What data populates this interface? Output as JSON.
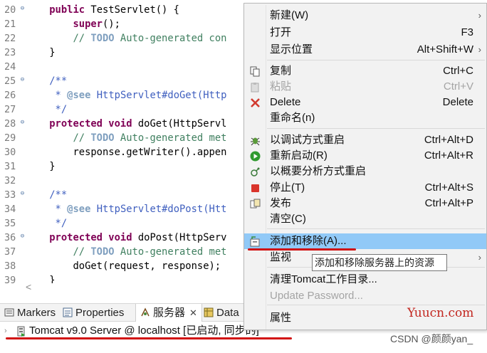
{
  "editor": {
    "lines": [
      {
        "n": "20",
        "fold": "⊖",
        "parts": [
          {
            "t": "    "
          },
          {
            "c": "kw",
            "t": "public"
          },
          {
            "t": " TestServlet() {"
          }
        ]
      },
      {
        "n": "21",
        "parts": [
          {
            "t": "        "
          },
          {
            "c": "kw",
            "t": "super"
          },
          {
            "t": "();"
          }
        ]
      },
      {
        "n": "22",
        "parts": [
          {
            "t": "        "
          },
          {
            "c": "cm",
            "t": "// "
          },
          {
            "c": "jt",
            "t": "TODO"
          },
          {
            "c": "cm",
            "t": " Auto-generated con"
          }
        ]
      },
      {
        "n": "23",
        "parts": [
          {
            "t": "    }"
          }
        ]
      },
      {
        "n": "24",
        "parts": [
          {
            "t": ""
          }
        ]
      },
      {
        "n": "25",
        "fold": "⊖",
        "parts": [
          {
            "t": "    "
          },
          {
            "c": "jd",
            "t": "/**"
          }
        ]
      },
      {
        "n": "26",
        "parts": [
          {
            "t": "     "
          },
          {
            "c": "jd",
            "t": "* "
          },
          {
            "c": "jt",
            "t": "@see"
          },
          {
            "c": "jd",
            "t": " HttpServlet#doGet(Http"
          }
        ]
      },
      {
        "n": "27",
        "parts": [
          {
            "t": "     "
          },
          {
            "c": "jd",
            "t": "*/"
          }
        ]
      },
      {
        "n": "28",
        "fold": "⊖",
        "parts": [
          {
            "t": "    "
          },
          {
            "c": "kw",
            "t": "protected void"
          },
          {
            "t": " doGet(HttpServl"
          }
        ]
      },
      {
        "n": "29",
        "parts": [
          {
            "t": "        "
          },
          {
            "c": "cm",
            "t": "// "
          },
          {
            "c": "jt",
            "t": "TODO"
          },
          {
            "c": "cm",
            "t": " Auto-generated met"
          }
        ]
      },
      {
        "n": "30",
        "parts": [
          {
            "t": "        response.getWriter().appen"
          }
        ]
      },
      {
        "n": "31",
        "parts": [
          {
            "t": "    }"
          }
        ]
      },
      {
        "n": "32",
        "parts": [
          {
            "t": ""
          }
        ]
      },
      {
        "n": "33",
        "fold": "⊖",
        "parts": [
          {
            "t": "    "
          },
          {
            "c": "jd",
            "t": "/**"
          }
        ]
      },
      {
        "n": "34",
        "parts": [
          {
            "t": "     "
          },
          {
            "c": "jd",
            "t": "* "
          },
          {
            "c": "jt",
            "t": "@see"
          },
          {
            "c": "jd",
            "t": " HttpServlet#doPost(Htt"
          }
        ]
      },
      {
        "n": "35",
        "parts": [
          {
            "t": "     "
          },
          {
            "c": "jd",
            "t": "*/"
          }
        ]
      },
      {
        "n": "36",
        "fold": "⊖",
        "parts": [
          {
            "t": "    "
          },
          {
            "c": "kw",
            "t": "protected void"
          },
          {
            "t": " doPost(HttpServ"
          }
        ]
      },
      {
        "n": "37",
        "parts": [
          {
            "t": "        "
          },
          {
            "c": "cm",
            "t": "// "
          },
          {
            "c": "jt",
            "t": "TODO"
          },
          {
            "c": "cm",
            "t": " Auto-generated met"
          }
        ]
      },
      {
        "n": "38",
        "parts": [
          {
            "t": "        doGet(request, response);"
          }
        ]
      },
      {
        "n": "39",
        "parts": [
          {
            "t": "    }"
          }
        ]
      }
    ]
  },
  "scroll_left_glyph": "<",
  "tabs": [
    {
      "label": "Markers",
      "icon": "markers-icon"
    },
    {
      "label": "Properties",
      "icon": "properties-icon"
    },
    {
      "label": "服务器",
      "icon": "servers-icon",
      "close": "✕"
    },
    {
      "label": "Data",
      "icon": "data-icon"
    }
  ],
  "server": {
    "expander": "›",
    "label": "Tomcat v9.0 Server @ localhost  [已启动, 同步的]",
    "icon": "tomcat-server-icon"
  },
  "menu": {
    "items": [
      {
        "label": "新建(W)",
        "shortcut": "",
        "submenu": true
      },
      {
        "label": "打开",
        "shortcut": "F3"
      },
      {
        "label": "显示位置",
        "shortcut": "Alt+Shift+W",
        "submenu": true
      },
      {
        "label": "复制",
        "shortcut": "Ctrl+C",
        "icon": "copy-icon"
      },
      {
        "label": "粘贴",
        "shortcut": "Ctrl+V",
        "icon": "paste-icon",
        "disabled": true
      },
      {
        "label": "Delete",
        "shortcut": "Delete",
        "icon": "delete-icon"
      },
      {
        "label": "重命名(n)",
        "shortcut": ""
      },
      {
        "label": "以调试方式重启",
        "shortcut": "Ctrl+Alt+D",
        "icon": "debug-icon"
      },
      {
        "label": "重新启动(R)",
        "shortcut": "Ctrl+Alt+R",
        "icon": "run-icon"
      },
      {
        "label": "以概要分析方式重启",
        "shortcut": "",
        "icon": "profile-icon"
      },
      {
        "label": "停止(T)",
        "shortcut": "Ctrl+Alt+S",
        "icon": "stop-icon"
      },
      {
        "label": "发布",
        "shortcut": "Ctrl+Alt+P",
        "icon": "publish-icon"
      },
      {
        "label": "清空(C)",
        "shortcut": ""
      },
      {
        "label": "添加和移除(A)...",
        "shortcut": "",
        "icon": "add-remove-icon",
        "highlighted": true
      },
      {
        "label": "监视",
        "shortcut": "",
        "submenu": true
      },
      {
        "label": "清理Tomcat工作目录...",
        "shortcut": ""
      },
      {
        "label": "Update Password...",
        "shortcut": "",
        "disabled": true
      },
      {
        "label": "属性",
        "shortcut": ""
      }
    ],
    "submenu_glyph": "›"
  },
  "tooltip": "添加和移除服务器上的资源",
  "watermark": "Yuucn.com",
  "credit": "CSDN @颜颜yan_",
  "colors": {
    "keyword": "#7f0055",
    "comment": "#3f7f5f",
    "javadoc": "#3f5fbf",
    "menu_highlight": "#91c9f7",
    "annotation_underline": "#d10f0f"
  }
}
